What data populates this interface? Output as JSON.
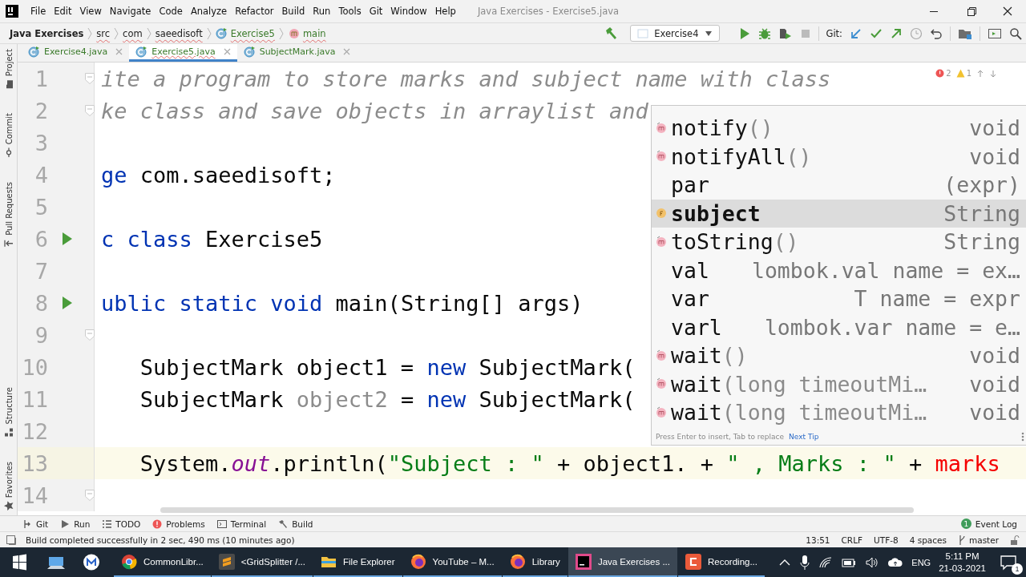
{
  "window": {
    "title": "Java Exercises - Exercise5.java"
  },
  "menu": [
    "File",
    "Edit",
    "View",
    "Navigate",
    "Code",
    "Analyze",
    "Refactor",
    "Build",
    "Run",
    "Tools",
    "Git",
    "Window",
    "Help"
  ],
  "breadcrumbs": [
    {
      "label": "Java Exercises",
      "kind": "project"
    },
    {
      "label": "src",
      "kind": "folder"
    },
    {
      "label": "com",
      "kind": "folder"
    },
    {
      "label": "saeedisoft",
      "kind": "folder"
    },
    {
      "label": "Exercise5",
      "kind": "class"
    },
    {
      "label": "main",
      "kind": "method"
    }
  ],
  "toolbar": {
    "run_config": "Exercise4",
    "git_label": "Git:"
  },
  "tabs": [
    {
      "label": "Exercise4.java",
      "selected": false
    },
    {
      "label": "Exercise5.java",
      "selected": true
    },
    {
      "label": "SubjectMark.java",
      "selected": false
    }
  ],
  "tool_strip": {
    "top": [
      {
        "label": "Project",
        "kind": "folder"
      },
      {
        "label": "Commit",
        "kind": "commit"
      },
      {
        "label": "Pull Requests",
        "kind": "pull"
      }
    ],
    "bottom": [
      {
        "label": "Structure",
        "kind": "structure"
      },
      {
        "label": "Favorites",
        "kind": "star"
      }
    ]
  },
  "inspections": {
    "errors": "2",
    "warnings": "1"
  },
  "lines": [
    {
      "number": "1",
      "run": false,
      "fold": true,
      "current": false,
      "tokens": [
        {
          "kind": "comment",
          "text": "ite a program to store marks and subject name with class"
        }
      ]
    },
    {
      "number": "2",
      "run": false,
      "fold": true,
      "current": false,
      "tokens": [
        {
          "kind": "comment",
          "text": "ke class and save objects in arraylist and"
        }
      ]
    },
    {
      "number": "3",
      "run": false,
      "fold": false,
      "current": false
    },
    {
      "number": "4",
      "run": false,
      "fold": false,
      "current": false,
      "tokens": [
        {
          "kind": "keyword",
          "text": "ge"
        },
        {
          "kind": "plain",
          "text": " com.saeedisoft;"
        }
      ]
    },
    {
      "number": "5",
      "run": false,
      "fold": false,
      "current": false
    },
    {
      "number": "6",
      "run": true,
      "fold": false,
      "current": false,
      "tokens": [
        {
          "kind": "keyword",
          "text": "c class"
        },
        {
          "kind": "plain",
          "text": " Exercise5"
        }
      ]
    },
    {
      "number": "7",
      "run": false,
      "fold": false,
      "current": false
    },
    {
      "number": "8",
      "run": true,
      "fold": false,
      "current": false,
      "tokens": [
        {
          "kind": "keyword",
          "text": "ublic static void"
        },
        {
          "kind": "plain",
          "text": " main(String[] args)"
        }
      ]
    },
    {
      "number": "9",
      "run": false,
      "fold": true,
      "current": false
    },
    {
      "number": "10",
      "run": false,
      "fold": false,
      "current": false,
      "tokens": [
        {
          "kind": "plain",
          "text": "   SubjectMark object1 = "
        },
        {
          "kind": "keyword",
          "text": "new"
        },
        {
          "kind": "plain",
          "text": " SubjectMark("
        }
      ]
    },
    {
      "number": "11",
      "run": false,
      "fold": false,
      "current": false,
      "tokens": [
        {
          "kind": "plain",
          "text": "   SubjectMark "
        },
        {
          "kind": "unused",
          "text": "object2"
        },
        {
          "kind": "plain",
          "text": " = "
        },
        {
          "kind": "keyword",
          "text": "new"
        },
        {
          "kind": "plain",
          "text": " SubjectMark("
        }
      ]
    },
    {
      "number": "12",
      "run": false,
      "fold": false,
      "current": false
    },
    {
      "number": "13",
      "run": false,
      "fold": false,
      "current": true,
      "tokens": [
        {
          "kind": "plain",
          "text": "   System."
        },
        {
          "kind": "static",
          "text": "out"
        },
        {
          "kind": "plain",
          "text": ".println("
        },
        {
          "kind": "string",
          "text": "\"Subject : \""
        },
        {
          "kind": "plain",
          "text": " + object1. + "
        },
        {
          "kind": "string",
          "text": "\" , Marks : \""
        },
        {
          "kind": "plain",
          "text": " + "
        },
        {
          "kind": "error",
          "text": "marks"
        }
      ]
    },
    {
      "number": "14",
      "run": false,
      "fold": true,
      "current": false
    }
  ],
  "completion": {
    "items": [
      {
        "kind": "method",
        "name": "notify",
        "params": "()",
        "detail": "void",
        "selected": false
      },
      {
        "kind": "method",
        "name": "notifyAll",
        "params": "()",
        "detail": "void",
        "selected": false
      },
      {
        "kind": "template",
        "name": "par",
        "detail": "(expr)",
        "selected": false
      },
      {
        "kind": "field",
        "name": "subject",
        "detail": "String",
        "selected": true
      },
      {
        "kind": "method",
        "name": "toString",
        "params": "()",
        "detail": "String",
        "selected": false
      },
      {
        "kind": "template",
        "name": "val",
        "detail": "lombok.val name = ex…",
        "selected": false
      },
      {
        "kind": "template",
        "name": "var",
        "detail": "T name = expr",
        "selected": false
      },
      {
        "kind": "template",
        "name": "varl",
        "detail": "lombok.var name = e…",
        "selected": false
      },
      {
        "kind": "method",
        "name": "wait",
        "params": "()",
        "detail": "void",
        "selected": false
      },
      {
        "kind": "method",
        "name": "wait",
        "params": "(long timeoutMi…",
        "detail": "void",
        "selected": false
      },
      {
        "kind": "method",
        "name": "wait",
        "params": "(long timeoutMi…",
        "detail": "void",
        "selected": false
      }
    ],
    "hint": "Press Enter to insert, Tab to replace",
    "tip_link": "Next Tip"
  },
  "tool_windows": [
    {
      "label": "Git",
      "kind": "git"
    },
    {
      "label": "Run",
      "kind": "run"
    },
    {
      "label": "TODO",
      "kind": "todo"
    },
    {
      "label": "Problems",
      "kind": "problems"
    },
    {
      "label": "Terminal",
      "kind": "terminal"
    },
    {
      "label": "Build",
      "kind": "build"
    }
  ],
  "event_log": {
    "label": "Event Log",
    "count": "1"
  },
  "status": {
    "message": "Build completed successfully in 2 sec, 490 ms (10 minutes ago)",
    "position": "13:51",
    "line_ending": "CRLF",
    "encoding": "UTF-8",
    "indent": "4 spaces",
    "branch": "master"
  },
  "taskbar": {
    "apps": [
      {
        "label": "CommonLibr...",
        "kind": "chrome",
        "selected": false
      },
      {
        "label": "<GridSplitter /...",
        "kind": "sublime",
        "selected": false
      },
      {
        "label": "File Explorer",
        "kind": "explorer",
        "selected": false
      },
      {
        "label": "YouTube – M...",
        "kind": "firefox",
        "selected": false
      },
      {
        "label": "Library",
        "kind": "firefox",
        "selected": false
      },
      {
        "label": "Java Exercises ...",
        "kind": "intellij",
        "selected": true
      },
      {
        "label": "Recording...",
        "kind": "recorder",
        "selected": false
      }
    ],
    "language": "ENG",
    "time": "5:11 PM",
    "date": "21-03-2021",
    "notifications": "1"
  }
}
